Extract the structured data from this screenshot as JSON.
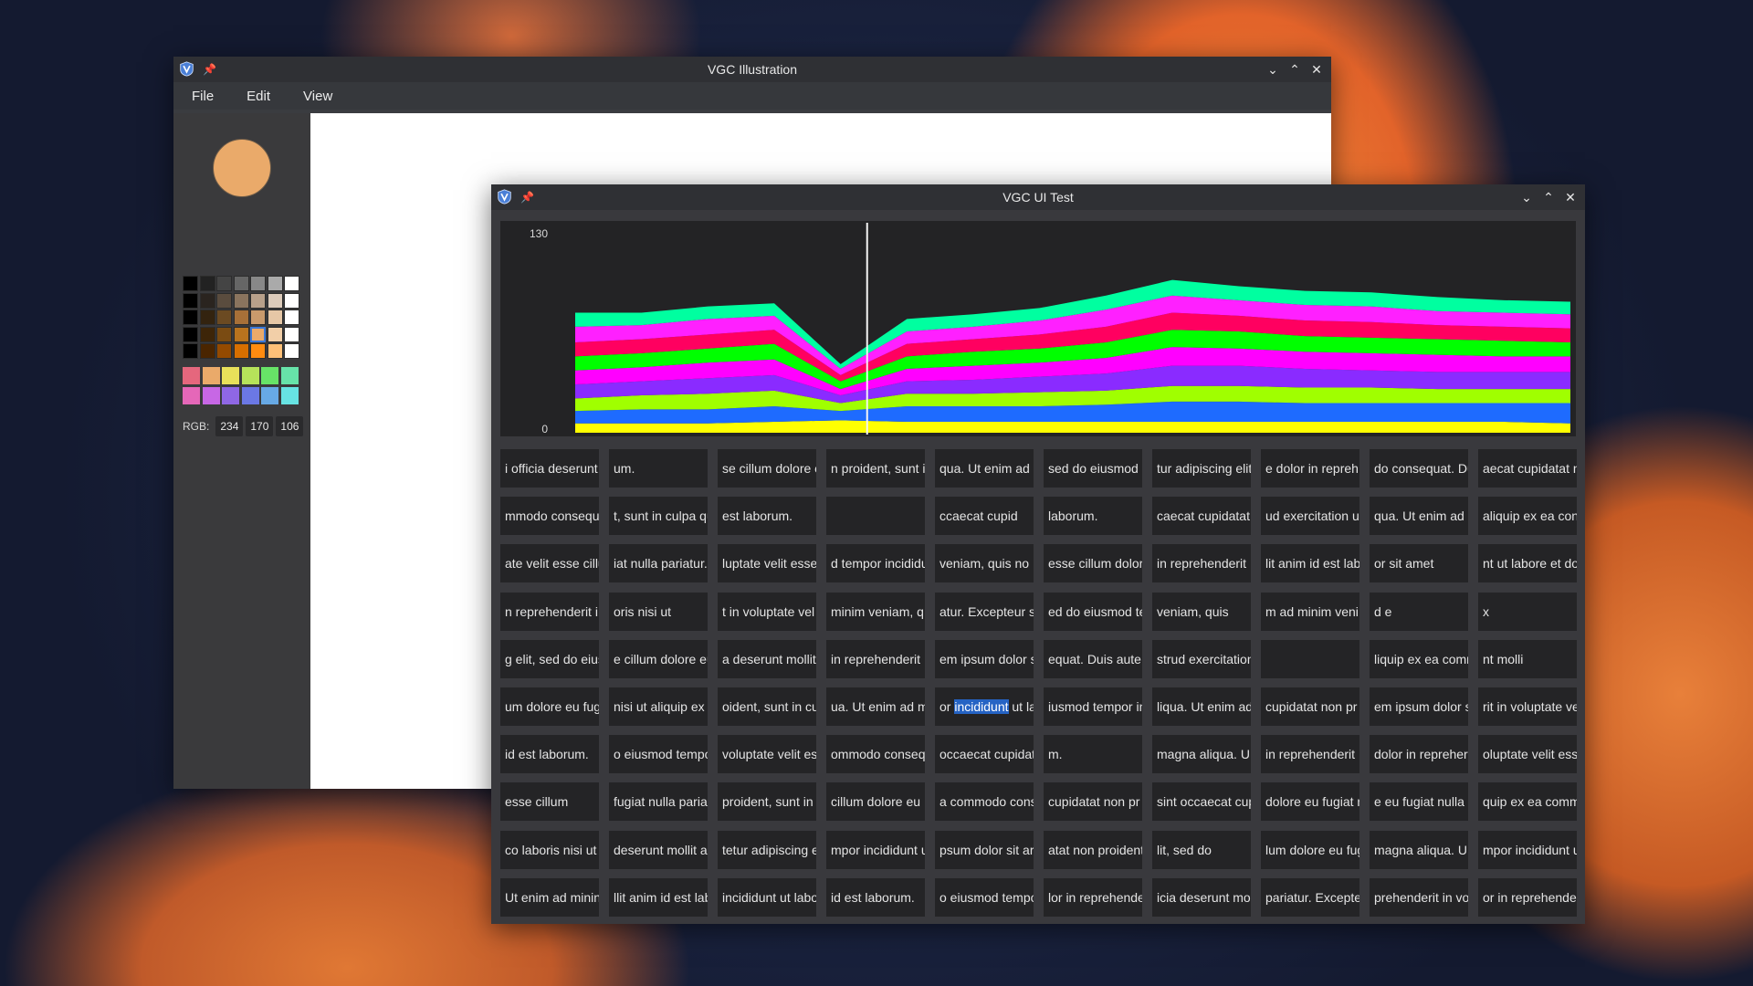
{
  "illustration_window": {
    "title": "VGC Illustration",
    "menu": [
      "File",
      "Edit",
      "View"
    ],
    "current_color": "#EAAA6A",
    "rgb_label": "RGB:",
    "rgb": {
      "r": "234",
      "g": "170",
      "b": "106"
    },
    "shade_grid": [
      [
        "#000000",
        "#222222",
        "#444444",
        "#666666",
        "#888888",
        "#aaaaaa",
        "#ffffff"
      ],
      [
        "#000000",
        "#2a241f",
        "#5a4c3e",
        "#8a745e",
        "#b8a08a",
        "#dccbbb",
        "#ffffff"
      ],
      [
        "#000000",
        "#33230f",
        "#6b4a22",
        "#a77038",
        "#c99a6c",
        "#e6c7a6",
        "#ffffff"
      ],
      [
        "#000000",
        "#3d2508",
        "#7a4b12",
        "#b8731e",
        "#eaaa6a",
        "#f2cfa8",
        "#ffffff"
      ],
      [
        "#000000",
        "#4a2500",
        "#944a00",
        "#d86f00",
        "#ff8c10",
        "#ffc078",
        "#ffffff"
      ]
    ],
    "swatches": [
      [
        "#e5677d",
        "#eaaa6a",
        "#e8e05a",
        "#b6e35a",
        "#67e367",
        "#67e3a9"
      ],
      [
        "#e567b8",
        "#c767e5",
        "#8f67e5",
        "#6b78e5",
        "#67a9e5",
        "#67e3e3"
      ]
    ]
  },
  "uitest_window": {
    "title": "VGC UI Test",
    "cells": [
      [
        "i officia deserunt",
        "um.",
        "se cillum dolore e",
        "n proident, sunt i",
        "qua. Ut enim ad n",
        "sed do eiusmod",
        "tur adipiscing elit",
        "e dolor in repreh",
        "do consequat. Du",
        "aecat cupidatat n"
      ],
      [
        "mmodo consequ",
        "t, sunt in culpa qu",
        " est laborum.",
        "",
        "ccaecat cupid",
        "laborum.",
        "caecat cupidatat",
        "ud exercitation u",
        "qua. Ut enim ad r",
        " aliquip ex ea con"
      ],
      [
        "ate velit esse cillu",
        "iat nulla pariatur.",
        "luptate velit esse",
        "d tempor incididu",
        " veniam, quis no",
        " esse cillum dolor",
        "in reprehenderit",
        "lit anim id est lab",
        "or sit amet",
        "nt ut labore et do"
      ],
      [
        "n reprehenderit i",
        "oris nisi ut",
        "t in voluptate vel",
        " minim veniam, q",
        "atur. Excepteur si",
        "ed do eiusmod te",
        " veniam, quis",
        "m ad minim veni",
        "d e",
        "x"
      ],
      [
        "g elit, sed do eius",
        "e cillum dolore eu",
        "a deserunt mollit",
        " in reprehenderit",
        " em ipsum dolor s",
        "equat. Duis aute i",
        "strud exercitation",
        "",
        "liquip ex ea comr",
        "nt molli"
      ],
      [
        "um dolore eu fug",
        "nisi ut aliquip ex",
        "oident, sunt in cu",
        "ua. Ut enim ad m",
        "",
        "iusmod tempor in",
        "liqua. Ut enim ad",
        " cupidatat non pr",
        "em ipsum dolor s",
        "rit in voluptate ve"
      ],
      [
        " id est laborum.",
        "o eiusmod tempo",
        " voluptate velit es",
        "ommodo conseq",
        "occaecat cupidat",
        "m.",
        " magna aliqua. U",
        " in reprehenderit",
        "dolor in repreher",
        "oluptate velit ess"
      ],
      [
        "esse cillum",
        " fugiat nulla paria",
        " proident, sunt in",
        " cillum dolore eu",
        "a commodo cons",
        " cupidatat non pr",
        " sint occaecat cup",
        "dolore eu fugiat n",
        "e eu fugiat nulla p",
        " quip ex ea comm"
      ],
      [
        "co laboris nisi ut",
        " deserunt mollit a",
        "tetur adipiscing e",
        "mpor incididunt u",
        "psum dolor sit ar",
        "atat non proident",
        "lit, sed do",
        "lum dolore eu fug",
        " magna aliqua. U",
        "mpor incididunt u"
      ],
      [
        "Ut enim ad minin",
        "llit anim id est lab",
        "incididunt ut labo",
        "id est laborum.",
        "o eiusmod tempo",
        "lor in reprehende",
        "icia deserunt mol",
        "pariatur. Excepte",
        "prehenderit in vo",
        "or in reprehende"
      ]
    ],
    "selected_cell": {
      "prefix": "or ",
      "highlight": "incididunt",
      "suffix": " ut la"
    }
  },
  "chart_data": {
    "type": "area",
    "stacked": true,
    "yticks": [
      "130",
      "0"
    ],
    "ylim": [
      0,
      130
    ],
    "x": [
      0,
      1,
      2,
      3,
      4,
      5,
      6,
      7,
      8,
      9,
      10,
      11,
      12,
      13,
      14,
      15
    ],
    "cursor_x": 4.4,
    "series": [
      {
        "color": "#ffff00",
        "values": [
          6,
          6,
          6,
          7,
          8,
          7,
          7,
          7,
          7,
          7,
          7,
          7,
          7,
          7,
          7,
          6
        ]
      },
      {
        "color": "#1e6bff",
        "values": [
          8,
          9,
          9,
          10,
          6,
          10,
          10,
          10,
          11,
          13,
          13,
          12,
          12,
          12,
          12,
          13
        ]
      },
      {
        "color": "#a0ff00",
        "values": [
          8,
          9,
          10,
          10,
          5,
          8,
          8,
          9,
          9,
          10,
          10,
          10,
          10,
          9,
          9,
          9
        ]
      },
      {
        "color": "#8a2bff",
        "values": [
          9,
          9,
          10,
          10,
          5,
          8,
          9,
          10,
          11,
          13,
          13,
          12,
          11,
          11,
          11,
          11
        ]
      },
      {
        "color": "#ff00ff",
        "values": [
          9,
          9,
          10,
          10,
          4,
          8,
          9,
          9,
          10,
          12,
          11,
          11,
          11,
          11,
          10,
          10
        ]
      },
      {
        "color": "#00ff00",
        "values": [
          9,
          9,
          9,
          10,
          5,
          8,
          9,
          9,
          10,
          11,
          11,
          10,
          10,
          10,
          10,
          9
        ]
      },
      {
        "color": "#ff0060",
        "values": [
          9,
          9,
          9,
          9,
          4,
          8,
          8,
          9,
          10,
          11,
          10,
          10,
          10,
          9,
          9,
          9
        ]
      },
      {
        "color": "#ff20ff",
        "values": [
          10,
          9,
          10,
          9,
          4,
          8,
          8,
          9,
          11,
          11,
          10,
          10,
          10,
          9,
          9,
          9
        ]
      },
      {
        "color": "#00ffa0",
        "values": [
          9,
          8,
          8,
          8,
          3,
          8,
          8,
          8,
          9,
          10,
          9,
          9,
          9,
          9,
          8,
          8
        ]
      }
    ]
  }
}
